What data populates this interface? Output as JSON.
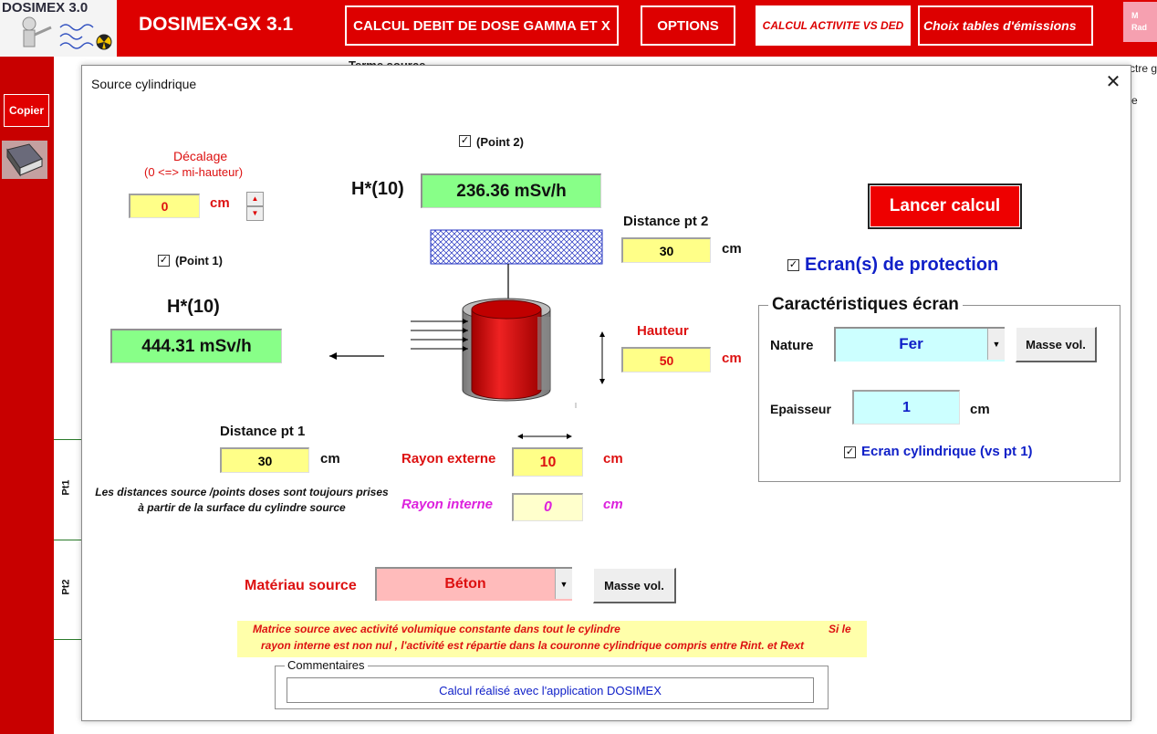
{
  "app": {
    "logo_text": "DOSIMEX 3.0",
    "title": "DOSIMEX-GX 3.1",
    "buttons": {
      "gamma": "CALCUL DEBIT DE DOSE GAMMA ET X",
      "options": "OPTIONS",
      "activite": "CALCUL ACTIVITE VS DED",
      "tables": "Choix tables d'émissions",
      "pink_line1": "M",
      "pink_line2": "Rad"
    }
  },
  "sidebar": {
    "copier": "Copier"
  },
  "background": {
    "terme_source": "Terme source",
    "right_text1": "ctre g",
    "right_text2": "e",
    "pt1": "Pt1",
    "pt2": "Pt2"
  },
  "dialog": {
    "title": "Source  cylindrique",
    "close": "✕",
    "decalage": {
      "label": "Décalage",
      "sub": "(0  <=> mi-hauteur)",
      "value": "0",
      "unit": "cm"
    },
    "point1": {
      "check_label": "(Point 1)",
      "checked": true,
      "h_label": "H*(10)",
      "result": "444.31 mSv/h"
    },
    "point2": {
      "check_label": "(Point 2)",
      "checked": true,
      "h_label": "H*(10)",
      "result": "236.36 mSv/h"
    },
    "distance_pt2": {
      "label": "Distance pt 2",
      "value": "30",
      "unit": "cm"
    },
    "hauteur": {
      "label": "Hauteur",
      "value": "50",
      "unit": "cm"
    },
    "distance_pt1": {
      "label": "Distance pt 1",
      "value": "30",
      "unit": "cm"
    },
    "rayon_externe": {
      "label": "Rayon externe",
      "value": "10",
      "unit": "cm"
    },
    "rayon_interne": {
      "label": "Rayon interne",
      "value": "0",
      "unit": "cm"
    },
    "note": "Les distances source /points doses sont toujours prises à partir de la surface du cylindre source",
    "lancer": "Lancer calcul",
    "ecran_protection": {
      "label": "Ecran(s) de protection",
      "checked": true
    },
    "caracteristiques": {
      "title": "Caractéristiques écran",
      "nature_label": "Nature",
      "nature_value": "Fer",
      "masse_btn": "Masse vol.",
      "epaisseur_label": "Epaisseur",
      "epaisseur_value": "1",
      "epaisseur_unit": "cm",
      "cylindrique_label": "Ecran cylindrique (vs pt 1)",
      "cylindrique_checked": true
    },
    "materiau": {
      "label": "Matériau source",
      "value": "Béton",
      "masse_btn": "Masse vol."
    },
    "matrice_note_1": "Matrice source avec activité volumique constante dans tout le cylindre",
    "matrice_note_2": "Si le",
    "matrice_note_3": "rayon interne est non nul , l'activité est répartie dans la couronne cylindrique compris entre Rint. et Rext",
    "commentaires": {
      "legend": "Commentaires",
      "value": "Calcul réalisé avec l'application DOSIMEX"
    },
    "colors": {
      "field_yellow": "#ffff88",
      "result_green": "#88ff88",
      "screen_cyan": "#ccffff",
      "source_pink": "#ffbbbb",
      "accent_red": "#dd0000"
    }
  }
}
